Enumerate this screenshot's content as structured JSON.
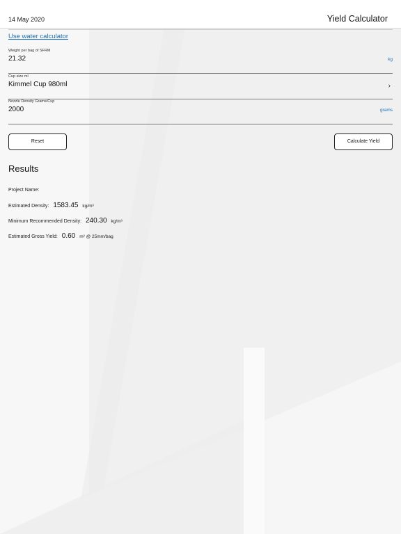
{
  "header": {
    "date": "14 May 2020",
    "title": "Yield Calculator"
  },
  "links": {
    "water": "Use water calculator"
  },
  "fields": [
    {
      "label": "Weight per bag of SFRM",
      "value": "21.32",
      "unit": "kg"
    },
    {
      "label": "Cup size ml",
      "value": "Kimmel Cup 980ml",
      "unit": ""
    },
    {
      "label": "Nozzle Density Grams/Cup",
      "value": "2000",
      "unit": "grams"
    }
  ],
  "buttons": {
    "reset": "Reset",
    "calculate": "Calculate Yield"
  },
  "results": {
    "title": "Results",
    "project_name_label": "Project Name:",
    "estimated_density_label": "Estimated Density:",
    "estimated_density_value": "1583.45",
    "estimated_density_unit": "kg/m³",
    "min_density_label": "Minimum Recommended Density:",
    "min_density_value": "240.30",
    "min_density_unit": "kg/m³",
    "gross_yield_label": "Estimated Gross Yield:",
    "gross_yield_value": "0.60",
    "gross_yield_unit": "m² @ 25mm/bag"
  },
  "colors": {
    "accent": "#1f6fb2"
  },
  "icons": {
    "cup_chevron": "chevron-right-icon"
  }
}
